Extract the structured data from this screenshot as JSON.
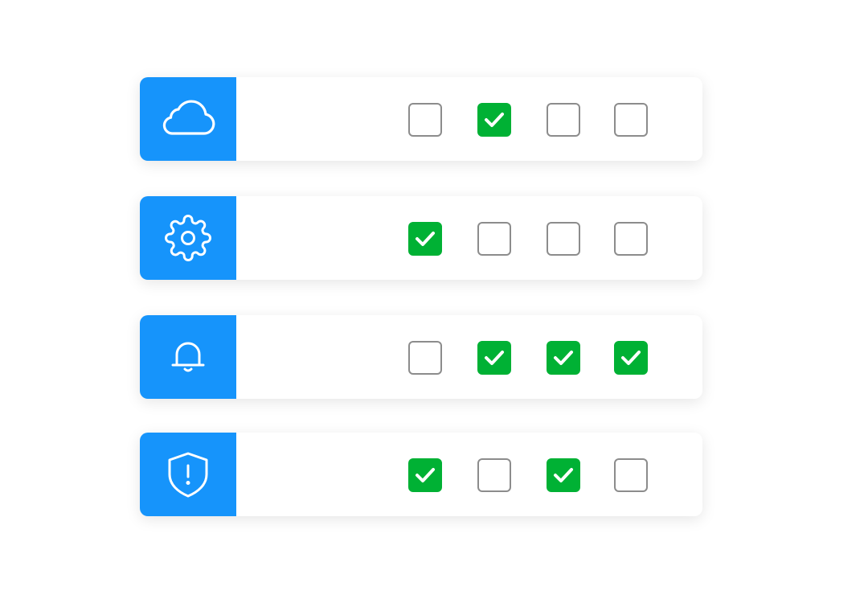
{
  "colors": {
    "icon_panel_bg": "#1694fb",
    "checked_bg": "#00b134",
    "unchecked_border": "#8c8c8c"
  },
  "rows": [
    {
      "icon": "cloud-icon",
      "checks": [
        false,
        true,
        false,
        false
      ]
    },
    {
      "icon": "gear-icon",
      "checks": [
        true,
        false,
        false,
        false
      ]
    },
    {
      "icon": "bell-icon",
      "checks": [
        false,
        true,
        true,
        true
      ]
    },
    {
      "icon": "shield-alert-icon",
      "checks": [
        true,
        false,
        true,
        false
      ]
    }
  ]
}
